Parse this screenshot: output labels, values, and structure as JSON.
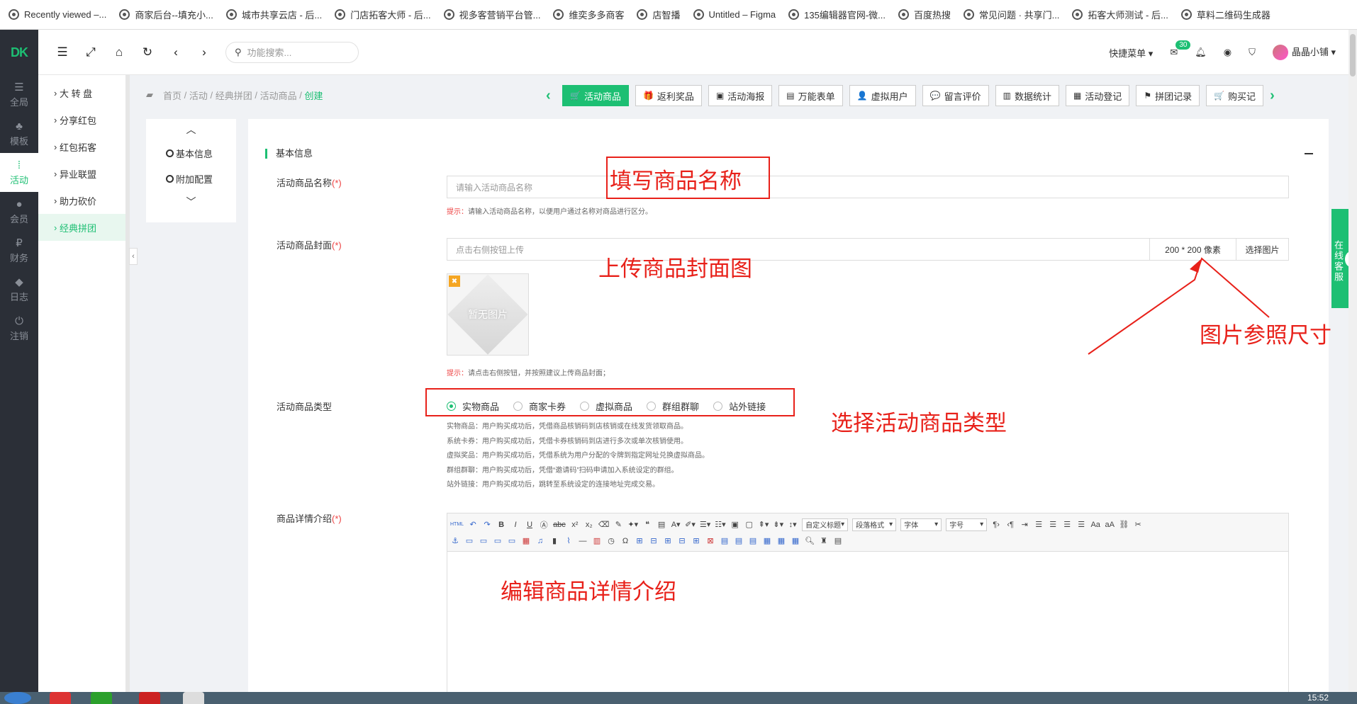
{
  "bookmarks": [
    "Recently viewed –...",
    "商家后台--填充小...",
    "城市共享云店 - 后...",
    "门店拓客大师 - 后...",
    "视多客营销平台管...",
    "维奕多多商客",
    "店智播",
    "Untitled – Figma",
    "135编辑器官网-微...",
    "百度热搜",
    "常见问题 · 共享门...",
    "拓客大师测试 - 后...",
    "草料二维码生成器"
  ],
  "rail": {
    "logo": "DK",
    "items": [
      {
        "label": "全局",
        "icon": "☰"
      },
      {
        "label": "模板",
        "icon": "♣"
      },
      {
        "label": "活动",
        "icon": "⁞"
      },
      {
        "label": "会员",
        "icon": "●"
      },
      {
        "label": "财务",
        "icon": "₽"
      },
      {
        "label": "日志",
        "icon": "◆"
      },
      {
        "label": "注销",
        "icon": "⏻"
      }
    ]
  },
  "topbar": {
    "search_placeholder": "功能搜索...",
    "quick_menu": "快捷菜单",
    "mail_badge": "30",
    "username": "晶晶小铺"
  },
  "submenu": {
    "items": [
      "大 转 盘",
      "分享红包",
      "红包拓客",
      "异业联盟",
      "助力砍价",
      "经典拼团"
    ]
  },
  "breadcrumb": {
    "parts": [
      "首页",
      "活动",
      "经典拼团",
      "活动商品"
    ],
    "current": "创建"
  },
  "tabs": [
    {
      "label": "活动商品",
      "icon": "🛒"
    },
    {
      "label": "返利奖品",
      "icon": "🎁"
    },
    {
      "label": "活动海报",
      "icon": "▣"
    },
    {
      "label": "万能表单",
      "icon": "▤"
    },
    {
      "label": "虚拟用户",
      "icon": "👤"
    },
    {
      "label": "留言评价",
      "icon": "💬"
    },
    {
      "label": "数据统计",
      "icon": "▥"
    },
    {
      "label": "活动登记",
      "icon": "▦"
    },
    {
      "label": "拼团记录",
      "icon": "⚑"
    },
    {
      "label": "购买记",
      "icon": "🛒"
    }
  ],
  "stepnav": {
    "items": [
      "基本信息",
      "附加配置"
    ]
  },
  "form": {
    "section_title": "基本信息",
    "name": {
      "label": "活动商品名称",
      "required": "(*)",
      "placeholder": "请输入活动商品名称",
      "hint_key": "提示：",
      "hint": "请输入活动商品名称，以便用户通过名称对商品进行区分。"
    },
    "cover": {
      "label": "活动商品封面",
      "required": "(*)",
      "placeholder": "点击右侧按钮上传",
      "size": "200 * 200 像素",
      "choose": "选择图片",
      "no_image": "暂无图片",
      "hint_key": "提示：",
      "hint": "请点击右侧按钮，并按照建议上传商品封面；"
    },
    "type": {
      "label": "活动商品类型",
      "options": [
        "实物商品",
        "商家卡券",
        "虚拟商品",
        "群组群聊",
        "站外链接"
      ],
      "selected": "实物商品",
      "descriptions": [
        "实物商品：用户购买成功后，凭借商品核销码到店核销或在线发货领取商品。",
        "系统卡券：用户购买成功后，凭借卡券核销码到店进行多次或单次核销使用。",
        "虚拟奖品：用户购买成功后，凭借系统为用户分配的令牌到指定网址兑换虚拟商品。",
        "群组群聊：用户购买成功后，凭借“邀请码”扫码申请加入系统设定的群组。",
        "站外链接：用户购买成功后，跳转至系统设定的连接地址完成交易。"
      ]
    },
    "detail": {
      "label": "商品详情介绍",
      "required": "(*)"
    }
  },
  "editor": {
    "selects": [
      "自定义标题",
      "段落格式",
      "字体",
      "字号"
    ],
    "html_label": "HTML"
  },
  "annotations": {
    "name": "填写商品名称",
    "cover": "上传商品封面图",
    "size": "图片参照尺寸",
    "type": "选择活动商品类型",
    "detail": "编辑商品详情介绍",
    "color": "#e8211a"
  },
  "service": "在线客服",
  "clock": "15:52"
}
